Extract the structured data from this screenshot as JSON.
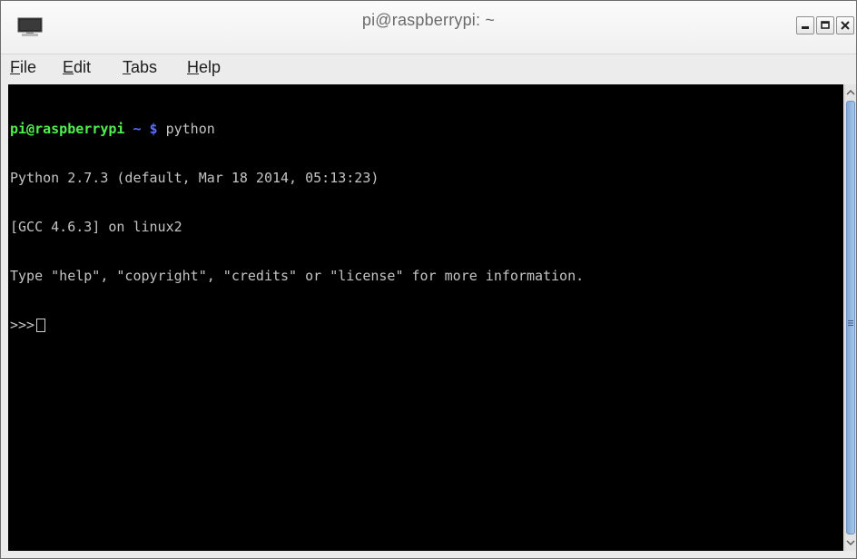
{
  "window": {
    "title": "pi@raspberrypi: ~",
    "icon": "terminal-icon"
  },
  "controls": {
    "minimize_icon": "minimize-icon",
    "maximize_icon": "maximize-icon",
    "close_icon": "close-icon"
  },
  "menu": {
    "items": [
      {
        "mnemonic": "F",
        "rest": "ile"
      },
      {
        "mnemonic": "E",
        "rest": "dit"
      },
      {
        "mnemonic": "T",
        "rest": "abs"
      },
      {
        "mnemonic": "H",
        "rest": "elp"
      }
    ]
  },
  "terminal": {
    "prompt_user": "pi@raspberrypi",
    "prompt_path": "~",
    "prompt_symbol": "$",
    "command": "python",
    "output": [
      "Python 2.7.3 (default, Mar 18 2014, 05:13:23)",
      "[GCC 4.6.3] on linux2",
      "Type \"help\", \"copyright\", \"credits\" or \"license\" for more information."
    ],
    "repl_prompt": ">>>"
  },
  "colors": {
    "background": "#000000",
    "text": "#c4c4c4",
    "prompt_user": "#4ef04e",
    "prompt_path": "#5b6cff",
    "scroll_thumb": "#7fa9d6"
  }
}
